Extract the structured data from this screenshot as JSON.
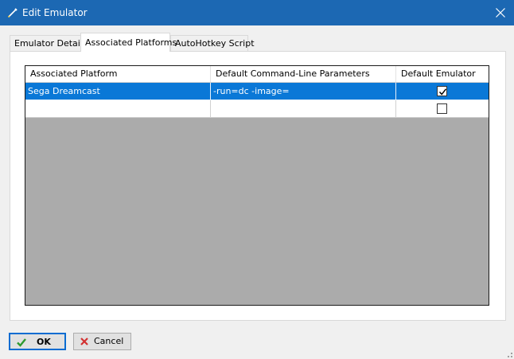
{
  "window": {
    "title": "Edit Emulator",
    "icon": "pencil-icon",
    "title_bar_color": "#1c68b3"
  },
  "tabs": [
    {
      "label": "Emulator Details",
      "active": false
    },
    {
      "label": "Associated Platforms",
      "active": true
    },
    {
      "label": "AutoHotkey Script",
      "active": false
    }
  ],
  "grid": {
    "columns": [
      "Associated Platform",
      "Default Command-Line Parameters",
      "Default Emulator"
    ],
    "rows": [
      {
        "platform": "Sega Dreamcast",
        "params": "-run=dc -image=",
        "default": true,
        "selected": true
      },
      {
        "platform": "",
        "params": "",
        "default": false,
        "selected": false
      }
    ],
    "selection_color": "#0a78d7",
    "background_color": "#ababab"
  },
  "buttons": {
    "ok": {
      "label": "OK",
      "icon": "checkmark-icon"
    },
    "cancel": {
      "label": "Cancel",
      "icon": "x-icon"
    }
  }
}
